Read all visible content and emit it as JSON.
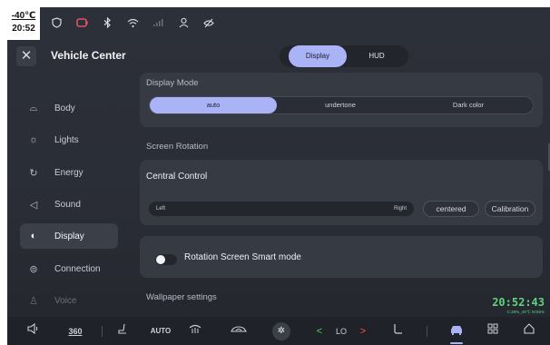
{
  "status": {
    "temperature": "-40℃",
    "time": "20:52",
    "icons": [
      "shield-icon",
      "battery-icon",
      "bluetooth-icon",
      "wifi-icon",
      "signal-icon",
      "user-icon",
      "hidden-eye-icon"
    ]
  },
  "header": {
    "title": "Vehicle Center",
    "tabs": [
      {
        "label": "Display",
        "active": true
      },
      {
        "label": "HUD",
        "active": false
      }
    ]
  },
  "sidebar": {
    "items": [
      {
        "label": "Body",
        "icon": "car-body-icon"
      },
      {
        "label": "Lights",
        "icon": "light-icon"
      },
      {
        "label": "Energy",
        "icon": "energy-icon"
      },
      {
        "label": "Sound",
        "icon": "speaker-icon"
      },
      {
        "label": "Display",
        "icon": "display-icon",
        "active": true
      },
      {
        "label": "Connection",
        "icon": "connection-icon"
      },
      {
        "label": "Voice",
        "icon": "voice-icon"
      }
    ]
  },
  "main": {
    "display_mode": {
      "label": "Display Mode",
      "options": [
        "auto",
        "undertone",
        "Dark color"
      ],
      "selected": "auto"
    },
    "screen_rotation": {
      "label": "Screen Rotation",
      "central_control": "Central Control",
      "slider_left": "Left",
      "slider_right": "Right",
      "centered_button": "centered",
      "calibration_button": "Calibration"
    },
    "smart_mode": {
      "label": "Rotation Screen Smart mode",
      "enabled": false
    },
    "wallpaper_label": "Wallpaper settings"
  },
  "overlay_clock": {
    "time": "20:52:43",
    "details": "C:28%_49℃ M:65%"
  },
  "dock": {
    "items": [
      "speaker-icon",
      "360",
      "seat-icon",
      "AUTO",
      "defrost-icon",
      "recirculation-icon",
      "fan-icon",
      "<",
      "LO",
      ">",
      "seat-heat-icon",
      "car-icon",
      "apps-icon",
      "home-icon"
    ],
    "temp_label": "LO",
    "auto_label": "AUTO",
    "view_label": "360"
  },
  "colors": {
    "accent": "#a9b3f6",
    "background": "#2c3038",
    "card": "#363a43",
    "clock_green": "#5fd47a",
    "arrow_left": "#4fcf6b",
    "arrow_right": "#ff4d4d"
  }
}
